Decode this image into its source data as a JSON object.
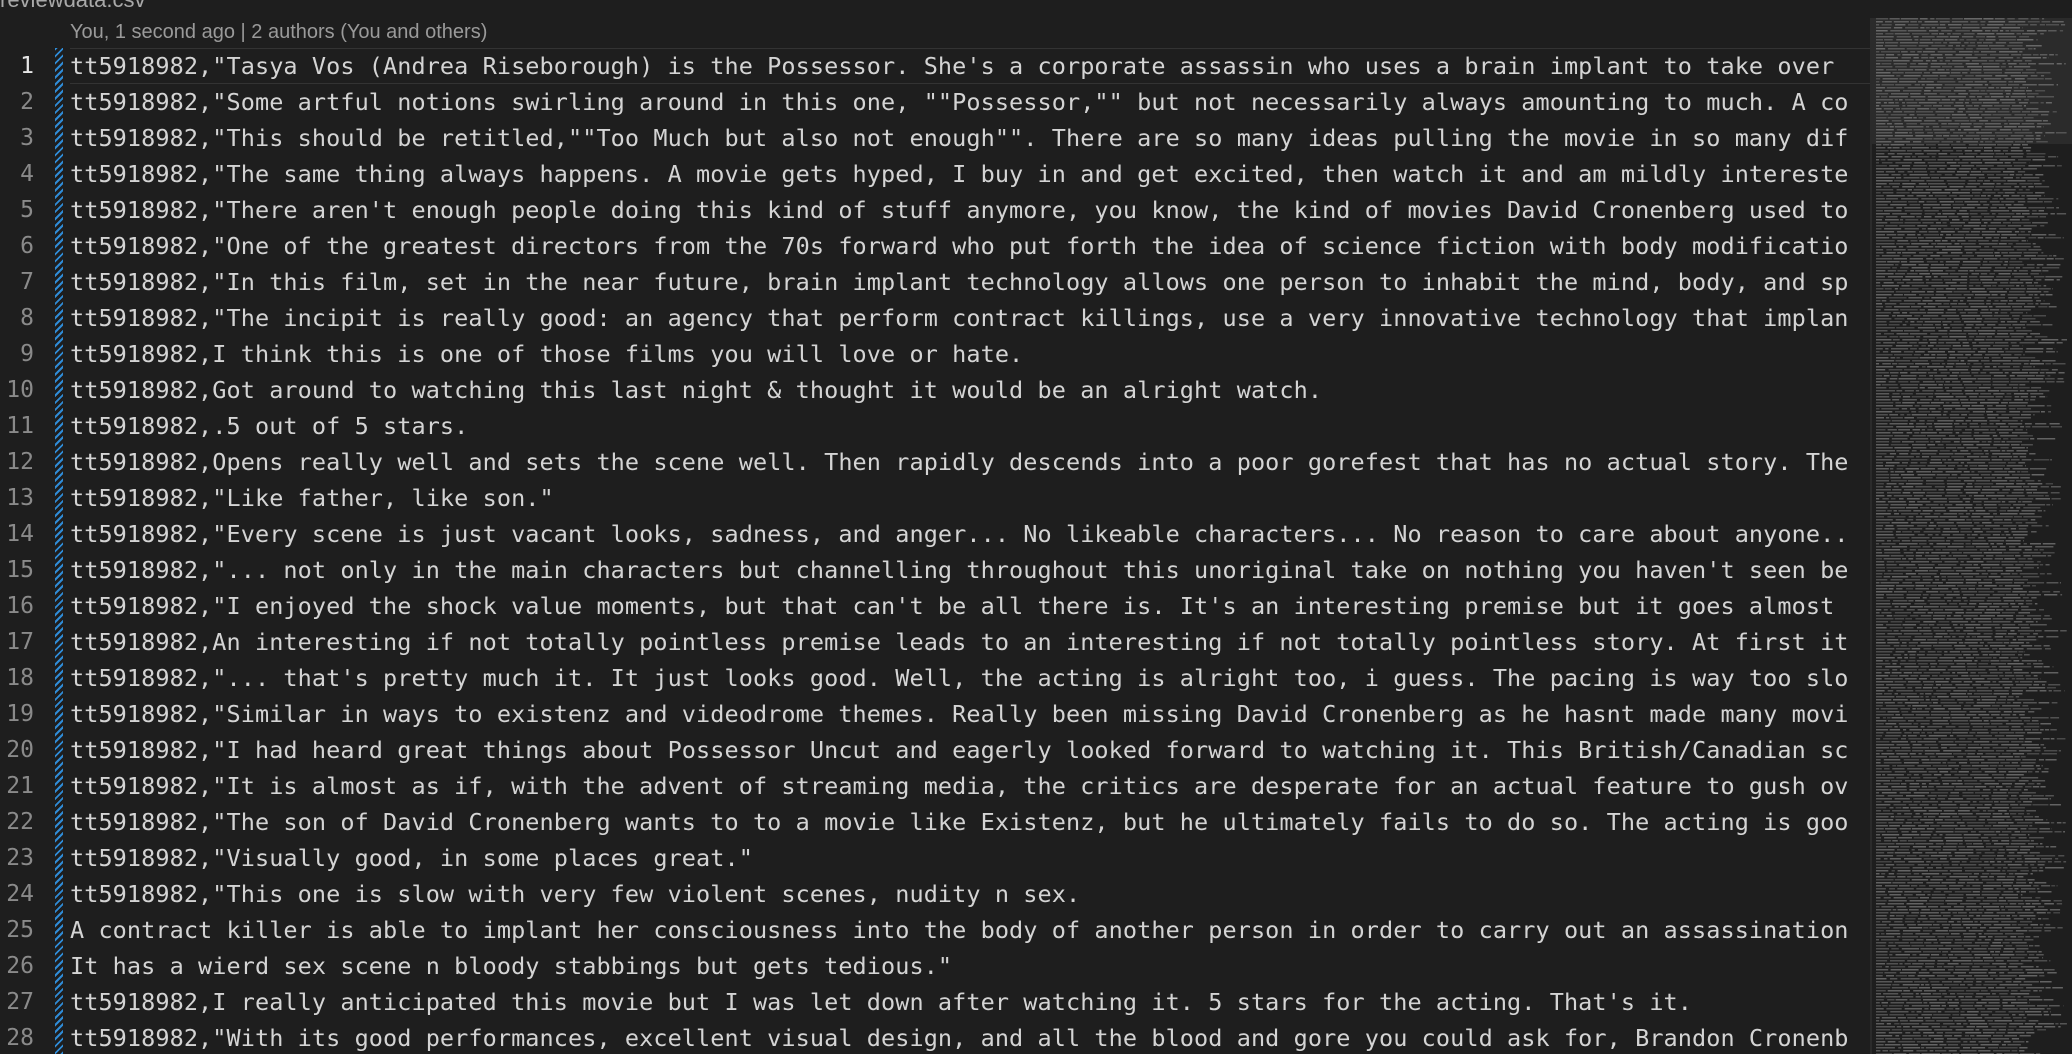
{
  "tab": {
    "filename": "reviewdata.csv"
  },
  "blame": {
    "text": "You, 1 second ago | 2 authors (You and others)"
  },
  "editor": {
    "active_line": 1,
    "lines": [
      {
        "number": "1",
        "text": "tt5918982,\"Tasya Vos (Andrea Riseborough) is the Possessor. She's a corporate assassin who uses a brain implant to take over"
      },
      {
        "number": "2",
        "text": "tt5918982,\"Some artful notions swirling around in this one, \"\"Possessor,\"\" but not necessarily always amounting to much. A co"
      },
      {
        "number": "3",
        "text": "tt5918982,\"This should be retitled,\"\"Too Much but also not enough\"\". There are so many ideas pulling the movie in so many dif"
      },
      {
        "number": "4",
        "text": "tt5918982,\"The same thing always happens. A movie gets hyped, I buy in and get excited, then watch it and am mildly intereste"
      },
      {
        "number": "5",
        "text": "tt5918982,\"There aren't enough people doing this kind of stuff anymore, you know, the kind of movies David Cronenberg used to"
      },
      {
        "number": "6",
        "text": "tt5918982,\"One of the greatest directors from the 70s forward who put forth the idea of science fiction with body modificatio"
      },
      {
        "number": "7",
        "text": "tt5918982,\"In this film, set in the near future, brain implant technology allows one person to inhabit the mind, body, and sp"
      },
      {
        "number": "8",
        "text": "tt5918982,\"The incipit is really good: an agency that perform contract killings, use a very innovative technology that implan"
      },
      {
        "number": "9",
        "text": "tt5918982,I think this is one of those films you will love or hate."
      },
      {
        "number": "10",
        "text": "tt5918982,Got around to watching this last night & thought it would be an alright watch."
      },
      {
        "number": "11",
        "text": "tt5918982,.5 out of 5 stars."
      },
      {
        "number": "12",
        "text": "tt5918982,Opens really well and sets the scene well. Then rapidly descends into a poor gorefest that has no actual story. The"
      },
      {
        "number": "13",
        "text": "tt5918982,\"Like father, like son.\""
      },
      {
        "number": "14",
        "text": "tt5918982,\"Every scene is just vacant looks, sadness, and anger... No likeable characters... No reason to care about anyone.."
      },
      {
        "number": "15",
        "text": "tt5918982,\"... not only in the main characters but channelling throughout this unoriginal take on nothing you haven't seen be"
      },
      {
        "number": "16",
        "text": "tt5918982,\"I enjoyed the shock value moments, but that can't be all there is. It's an interesting premise but it goes almost"
      },
      {
        "number": "17",
        "text": "tt5918982,An interesting if not totally pointless premise leads to an interesting if not totally pointless story. At first it"
      },
      {
        "number": "18",
        "text": "tt5918982,\"... that's pretty much it. It just looks good. Well, the acting is alright too, i guess. The pacing is way too slo"
      },
      {
        "number": "19",
        "text": "tt5918982,\"Similar in ways to existenz and videodrome themes. Really been missing David Cronenberg as he hasnt made many movi"
      },
      {
        "number": "20",
        "text": "tt5918982,\"I had heard great things about Possessor Uncut and eagerly looked forward to watching it. This British/Canadian sc"
      },
      {
        "number": "21",
        "text": "tt5918982,\"It is almost as if, with the advent of streaming media, the critics are desperate for an actual feature to gush ov"
      },
      {
        "number": "22",
        "text": "tt5918982,\"The son of David Cronenberg wants to to a movie like Existenz, but he ultimately fails to do so. The acting is goo"
      },
      {
        "number": "23",
        "text": "tt5918982,\"Visually good, in some places great.\""
      },
      {
        "number": "24",
        "text": "tt5918982,\"This one is slow with very few violent scenes, nudity n sex."
      },
      {
        "number": "25",
        "text": "A contract killer is able to implant her consciousness into the body of another person in order to carry out an assassination"
      },
      {
        "number": "26",
        "text": "It has a wierd sex scene n bloody stabbings but gets tedious.\""
      },
      {
        "number": "27",
        "text": "tt5918982,I really anticipated this movie but I was let down after watching it. 5 stars for the acting. That's it."
      },
      {
        "number": "28",
        "text": "tt5918982,\"With its good performances, excellent visual design, and all the blood and gore you could ask for, Brandon Cronenb"
      }
    ]
  },
  "colors": {
    "background": "#1e1e1e",
    "text": "#d4d4d4",
    "line_number": "#8a8a8a",
    "active_line_number": "#e6e6e6",
    "scm_modified": "#2f8bd6"
  }
}
